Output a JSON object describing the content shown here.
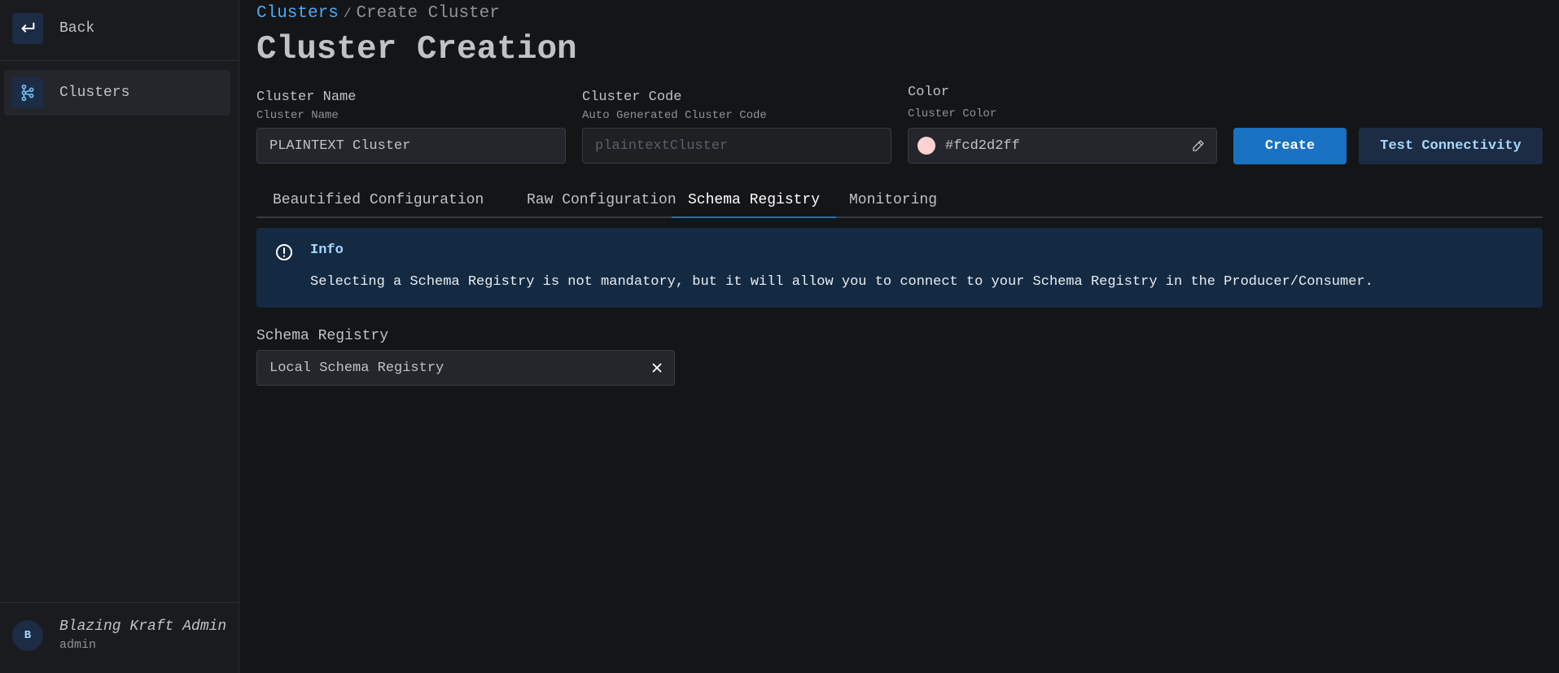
{
  "sidebar": {
    "back_label": "Back",
    "clusters_label": "Clusters",
    "user_initial": "B",
    "user_name": "Blazing Kraft Admin",
    "user_role": "admin"
  },
  "breadcrumb": {
    "link": "Clusters",
    "separator": "/",
    "current": "Create Cluster"
  },
  "page_title": "Cluster Creation",
  "form": {
    "cluster_name": {
      "label": "Cluster Name",
      "description": "Cluster Name",
      "value": "PLAINTEXT Cluster"
    },
    "cluster_code": {
      "label": "Cluster Code",
      "description": "Auto Generated Cluster Code",
      "placeholder": "plaintextCluster"
    },
    "color": {
      "label": "Color",
      "description": "Cluster Color",
      "value": "#fcd2d2ff",
      "swatch": "#fcd2d2"
    }
  },
  "buttons": {
    "create": "Create",
    "test": "Test Connectivity"
  },
  "tabs": [
    "Beautified Configuration",
    "Raw Configuration",
    "Schema Registry",
    "Monitoring"
  ],
  "active_tab": "Schema Registry",
  "alert": {
    "title": "Info",
    "text": "Selecting a Schema Registry is not mandatory, but it will allow you to connect to your Schema Registry in the Producer/Consumer."
  },
  "schema_registry": {
    "label": "Schema Registry",
    "value": "Local Schema Registry"
  },
  "colors": {
    "accent": "#1971c2",
    "link": "#4dabf7",
    "background": "#141517",
    "sidebar": "#1a1b1e"
  },
  "icons": [
    "back-arrow-icon",
    "clusters-icon",
    "info-circle-icon",
    "pencil-icon",
    "close-icon"
  ]
}
